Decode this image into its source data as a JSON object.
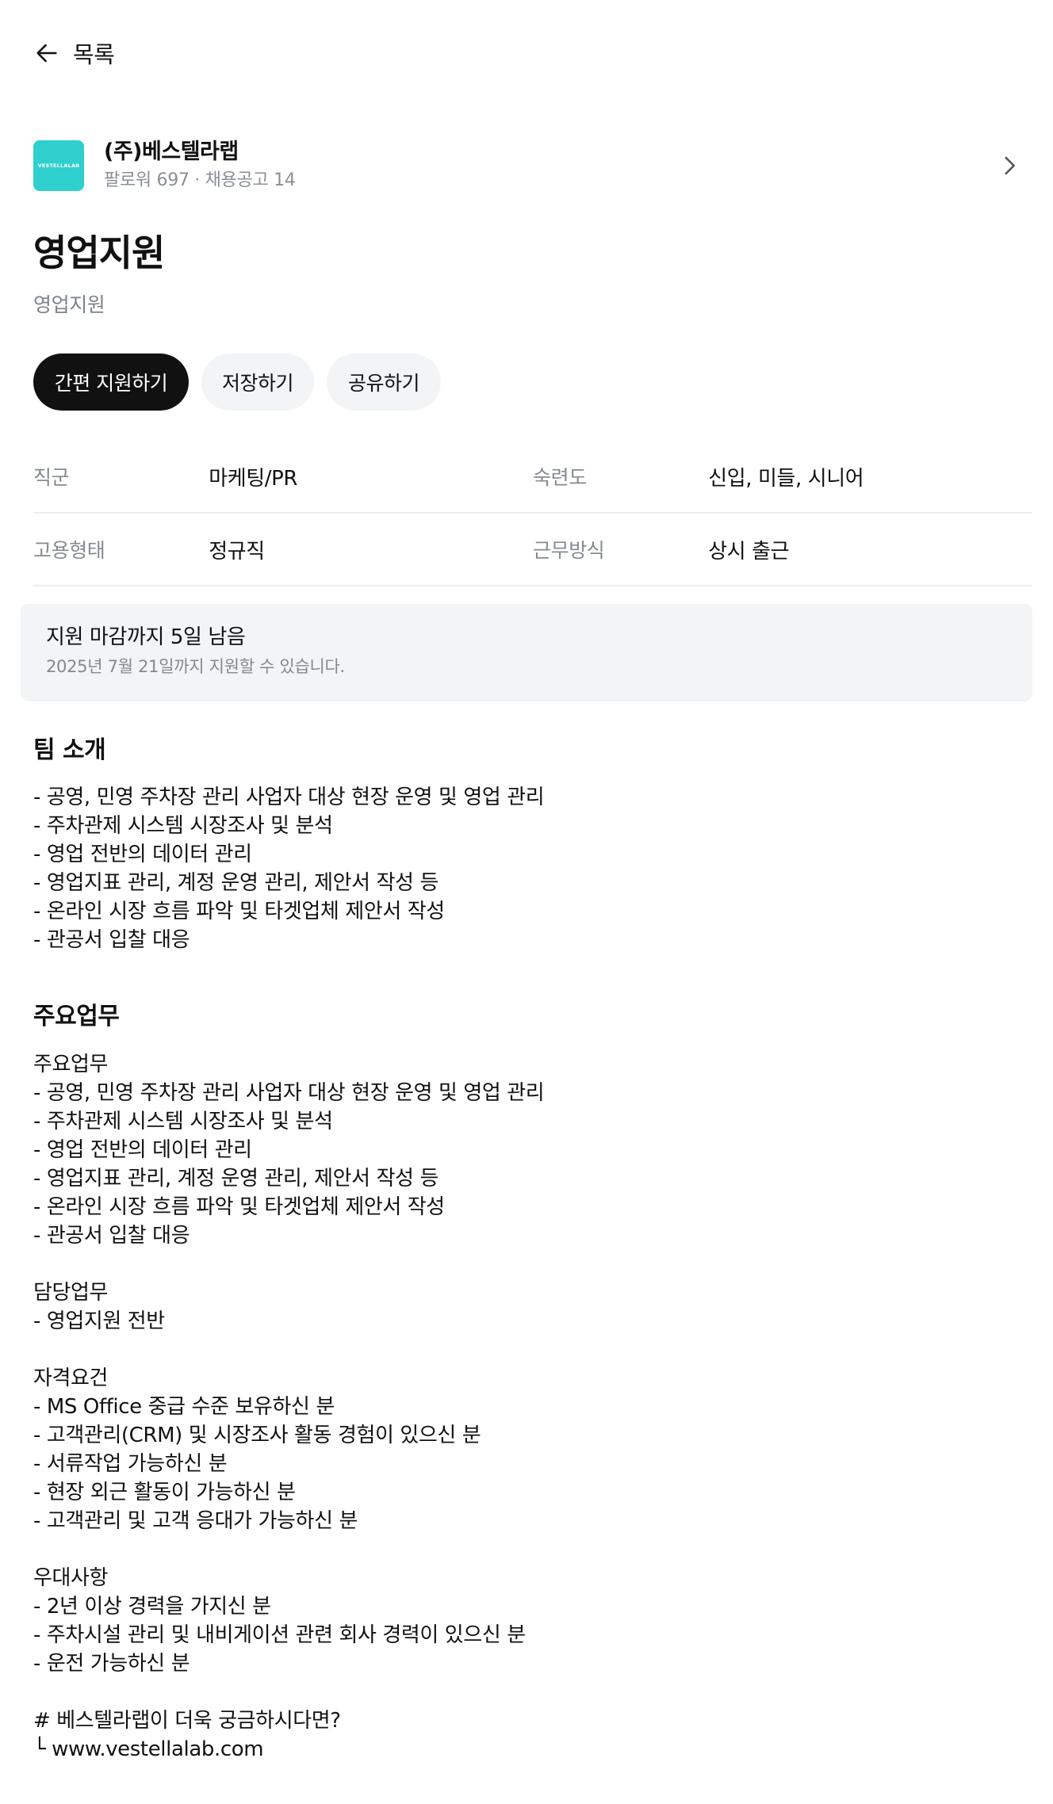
{
  "nav": {
    "back_label": "목록",
    "back_icon": "arrow-left-icon"
  },
  "company": {
    "logo_text": "VESTELLALAB",
    "logo_color": "#2ecfcd",
    "name": "(주)베스텔라랩",
    "meta": "팔로워 697 · 채용공고 14",
    "chevron_icon": "chevron-right-icon"
  },
  "job": {
    "title": "영업지원",
    "subtitle": "영업지원"
  },
  "actions": {
    "apply": "간편 지원하기",
    "save": "저장하기",
    "share": "공유하기"
  },
  "info": [
    {
      "label_left": "직군",
      "value_left": "마케팅/PR",
      "label_right": "숙련도",
      "value_right": "신입, 미들, 시니어"
    },
    {
      "label_left": "고용형태",
      "value_left": "정규직",
      "label_right": "근무방식",
      "value_right": "상시 출근"
    }
  ],
  "deadline": {
    "title": "지원 마감까지 5일 남음",
    "subtitle": "2025년 7월 21일까지 지원할 수 있습니다."
  },
  "team_intro": {
    "heading": "팀 소개",
    "lines": [
      "- 공영, 민영 주차장 관리 사업자 대상 현장 운영 및 영업 관리",
      "- 주차관제 시스템 시장조사 및 분석",
      "- 영업 전반의 데이터 관리",
      "- 영업지표 관리, 계정 운영 관리, 제안서 작성 등",
      "- 온라인 시장 흐름 파악 및 타겟업체 제안서 작성",
      "- 관공서 입찰 대응"
    ]
  },
  "main_duties": {
    "heading": "주요업무",
    "lines": [
      "주요업무",
      "- 공영, 민영 주차장 관리 사업자 대상 현장 운영 및 영업 관리",
      "- 주차관제 시스템 시장조사 및 분석",
      "- 영업 전반의 데이터 관리",
      "- 영업지표 관리, 계정 운영 관리, 제안서 작성 등",
      "- 온라인 시장 흐름 파악 및 타겟업체 제안서 작성",
      "- 관공서 입찰 대응",
      "",
      "담당업무",
      "- 영업지원 전반",
      "",
      "자격요건",
      "- MS Office 중급 수준 보유하신 분",
      "- 고객관리(CRM) 및 시장조사 활동 경험이 있으신 분",
      "- 서류작업 가능하신 분",
      "- 현장 외근 활동이 가능하신 분",
      "- 고객관리 및 고객 응대가 가능하신 분",
      "",
      "우대사항",
      "- 2년 이상 경력을 가지신 분",
      "- 주차시설 관리 및 내비게이션 관련 회사 경력이 있으신 분",
      "- 운전 가능하신 분",
      "",
      "# 베스텔라랩이 더욱 궁금하시다면?",
      "└ www.vestellalab.com"
    ]
  }
}
